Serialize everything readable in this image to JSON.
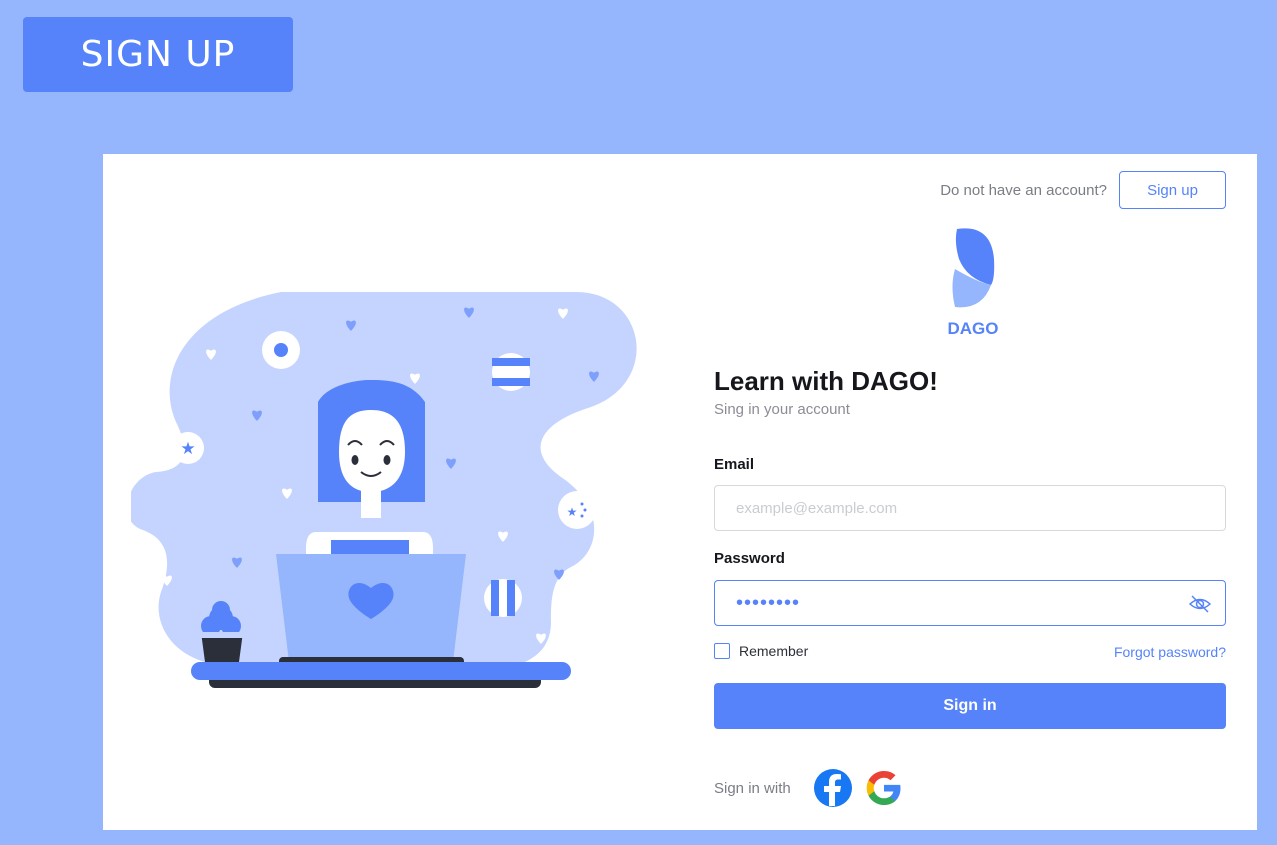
{
  "top_button": {
    "label": "SIGN UP"
  },
  "header": {
    "account_prompt": "Do not have an account?",
    "signup_label": "Sign up"
  },
  "logo": {
    "text": "DAGO"
  },
  "form": {
    "heading": "Learn with DAGO!",
    "subheading": "Sing in your account",
    "email_label": "Email",
    "email_placeholder": "example@example.com",
    "email_value": "",
    "password_label": "Password",
    "password_value": "••••••••",
    "remember_label": "Remember",
    "remember_checked": false,
    "forgot_label": "Forgot password?",
    "submit_label": "Sign in"
  },
  "social": {
    "label": "Sign in with",
    "providers": [
      "facebook-icon",
      "google-icon"
    ]
  },
  "colors": {
    "page_background": "#95b5fd",
    "primary": "#5683fa",
    "blob": "#c4d4fe",
    "card": "#ffffff"
  }
}
